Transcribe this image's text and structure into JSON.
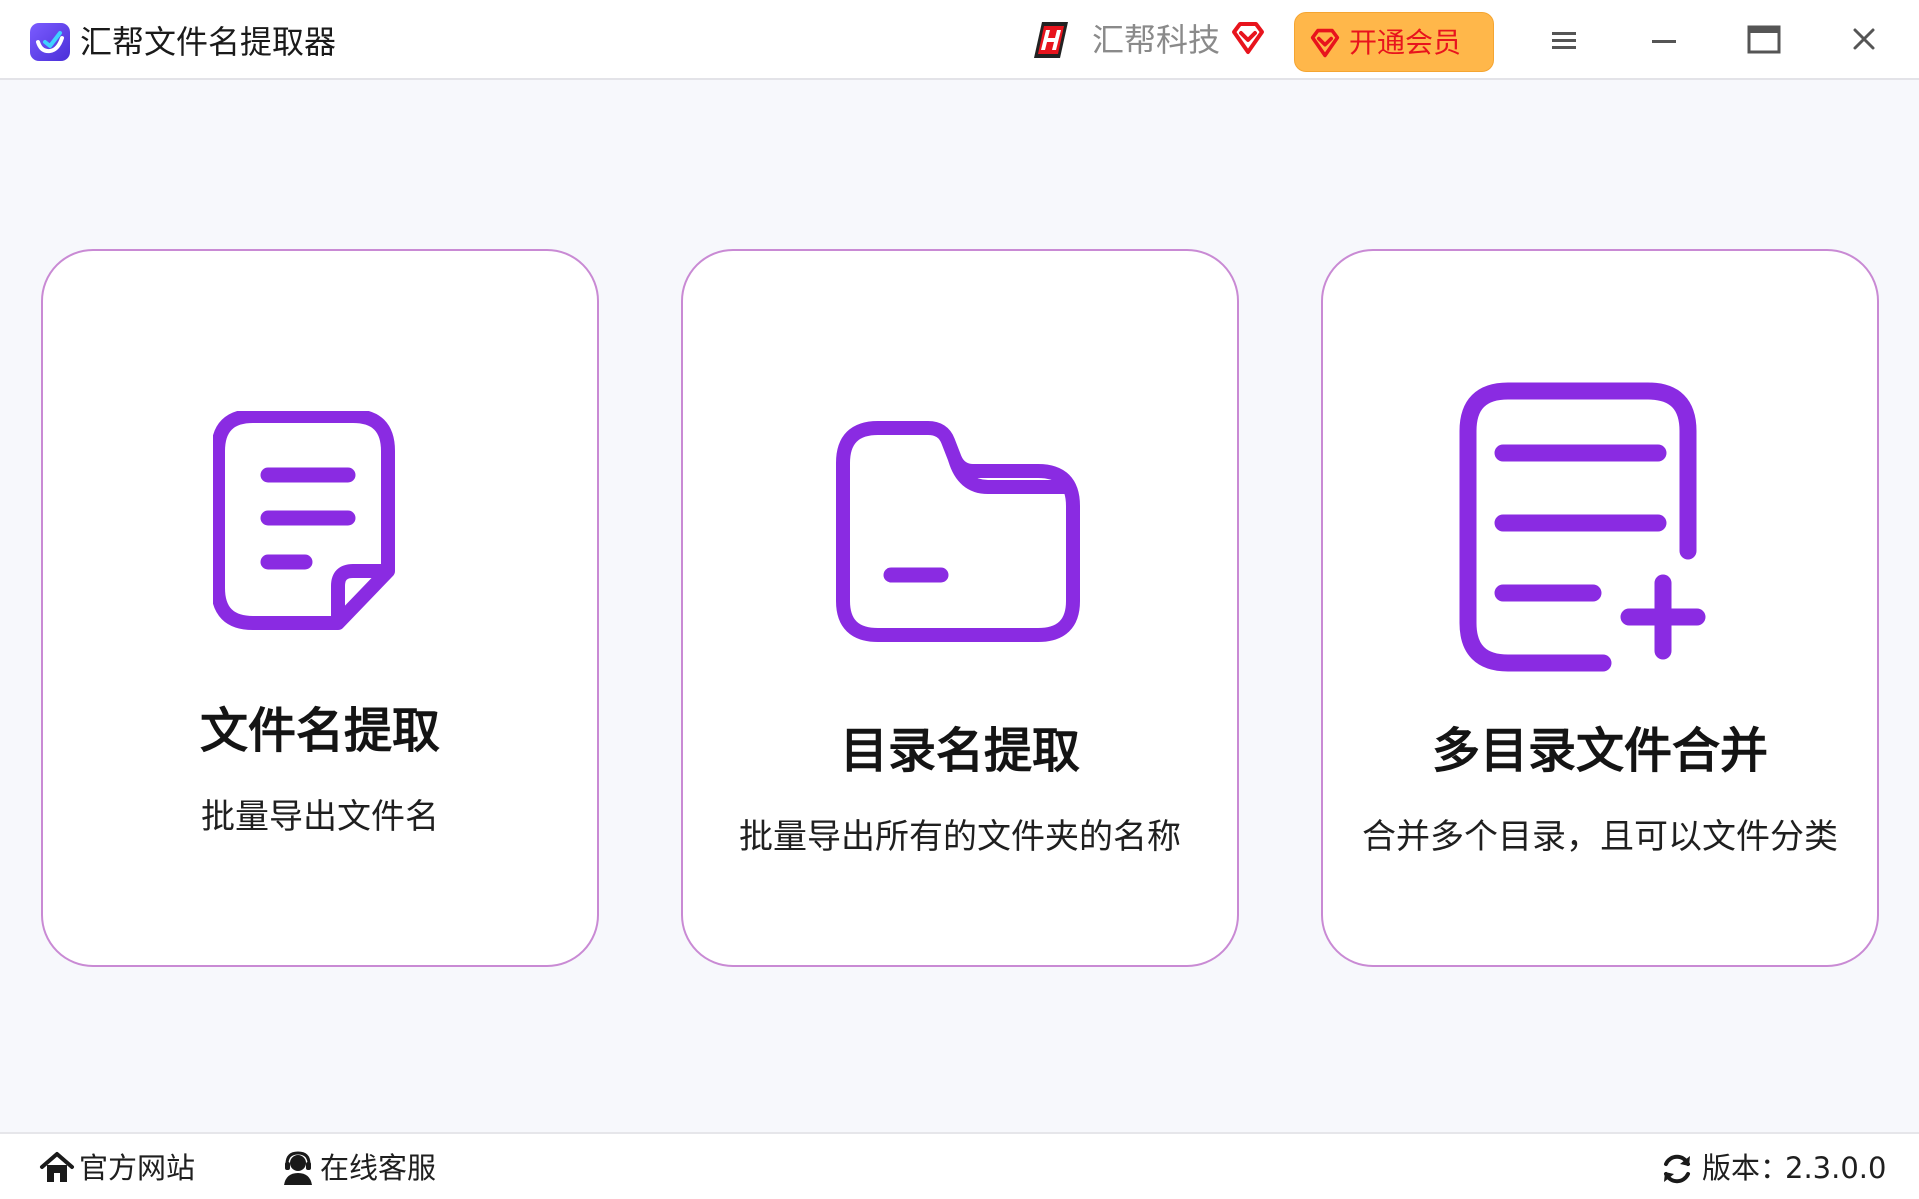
{
  "window": {
    "title": "汇帮文件名提取器",
    "brand_name": "汇帮科技",
    "vip_button_label": "开通会员",
    "controls": [
      "menu-icon",
      "minimize-icon",
      "maximize-icon",
      "close-icon"
    ]
  },
  "cards": [
    {
      "title": "文件名提取",
      "description": "批量导出文件名",
      "icon": "document-icon"
    },
    {
      "title": "目录名提取",
      "description": "批量导出所有的文件夹的名称",
      "icon": "folder-icon"
    },
    {
      "title": "多目录文件合并",
      "description": "合并多个目录，且可以文件分类",
      "icon": "list-add-icon"
    }
  ],
  "footer": {
    "website_label": "官方网站",
    "support_label": "在线客服",
    "version_label": "版本：",
    "version_value": "2.3.0.0"
  },
  "colors": {
    "accent_purple": "#8a2be2",
    "card_border": "#c98ad4",
    "vip_orange": "#ffb74a",
    "vip_red": "#e8141d",
    "background": "#f7f8fc"
  }
}
